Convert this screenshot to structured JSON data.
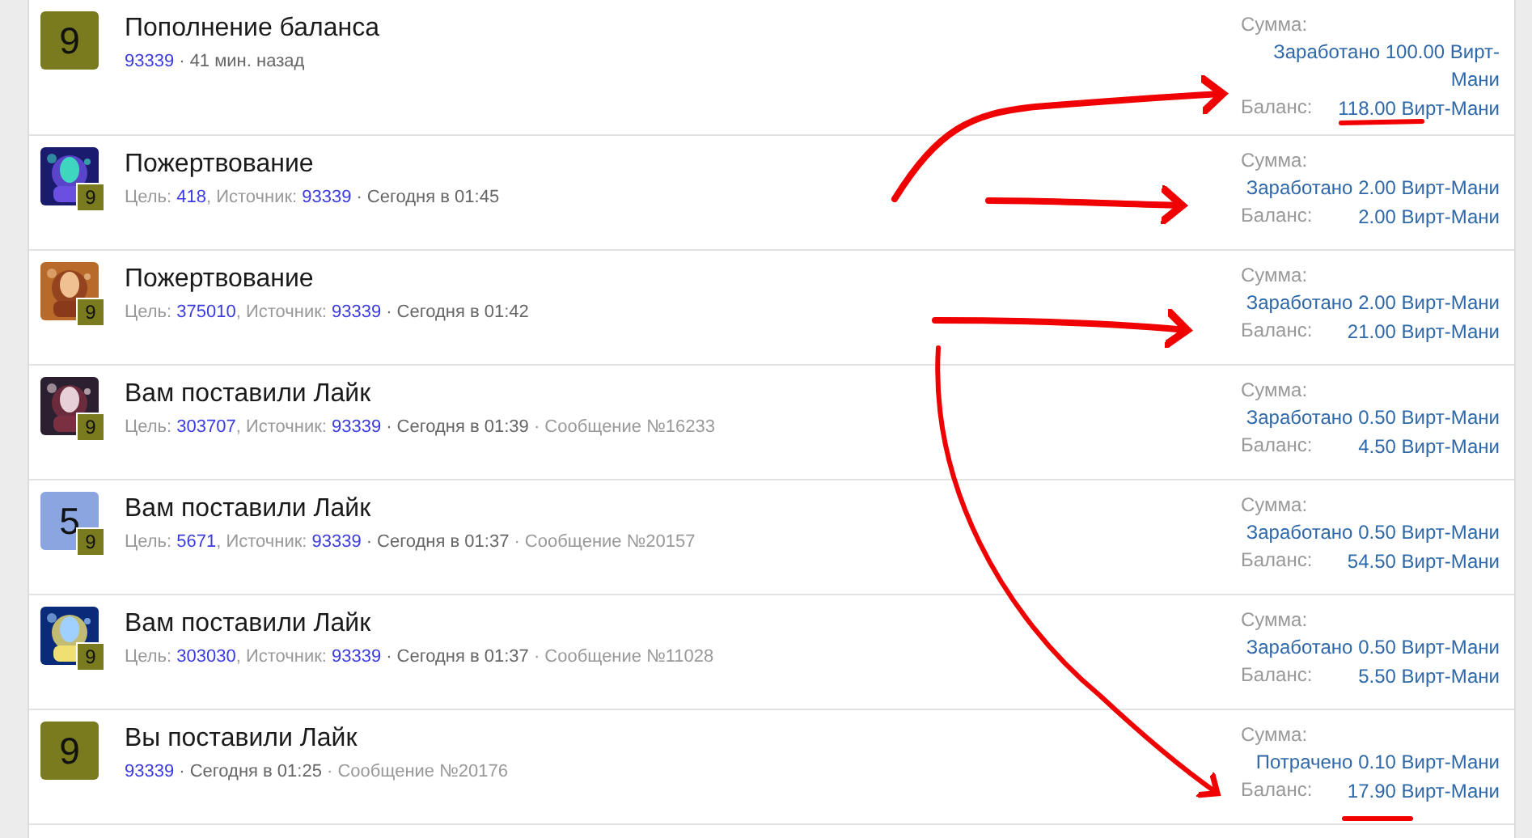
{
  "rows": [
    {
      "title": "Пополнение баланса",
      "avatar": {
        "kind": "number",
        "text": "9",
        "color": "#7a7a1e"
      },
      "meta": [
        {
          "kind": "link",
          "text": "93339"
        },
        {
          "kind": "time",
          "text": "· 41 мин. назад"
        }
      ],
      "sum_label": "Сумма:",
      "amount": "Заработано 100.00 Вирт-Мани",
      "balance_label": "Баланс:",
      "balance": "118.00 Вирт-Мани"
    },
    {
      "title": "Пожертвование",
      "avatar": {
        "kind": "picture",
        "badge": "9"
      },
      "meta": [
        {
          "kind": "label",
          "text": "Цель:"
        },
        {
          "kind": "link",
          "text": "418"
        },
        {
          "kind": "suffix",
          "text": ", Источник:"
        },
        {
          "kind": "link",
          "text": "93339"
        },
        {
          "kind": "time",
          "text": "· Сегодня в 01:45"
        }
      ],
      "sum_label": "Сумма:",
      "amount": "Заработано 2.00 Вирт-Мани",
      "balance_label": "Баланс:",
      "balance": "2.00 Вирт-Мани"
    },
    {
      "title": "Пожертвование",
      "avatar": {
        "kind": "picture",
        "badge": "9"
      },
      "meta": [
        {
          "kind": "label",
          "text": "Цель:"
        },
        {
          "kind": "link",
          "text": "375010"
        },
        {
          "kind": "suffix",
          "text": ", Источник:"
        },
        {
          "kind": "link",
          "text": "93339"
        },
        {
          "kind": "time",
          "text": "· Сегодня в 01:42"
        }
      ],
      "sum_label": "Сумма:",
      "amount": "Заработано 2.00 Вирт-Мани",
      "balance_label": "Баланс:",
      "balance": "21.00 Вирт-Мани"
    },
    {
      "title": "Вам поставили Лайк",
      "avatar": {
        "kind": "picture",
        "badge": "9"
      },
      "meta": [
        {
          "kind": "label",
          "text": "Цель:"
        },
        {
          "kind": "link",
          "text": "303707"
        },
        {
          "kind": "suffix",
          "text": ", Источник:"
        },
        {
          "kind": "link",
          "text": "93339"
        },
        {
          "kind": "time",
          "text": "· Сегодня в 01:39"
        },
        {
          "kind": "label",
          "text": "· Сообщение №16233"
        }
      ],
      "sum_label": "Сумма:",
      "amount": "Заработано 0.50 Вирт-Мани",
      "balance_label": "Баланс:",
      "balance": "4.50 Вирт-Мани"
    },
    {
      "title": "Вам поставили Лайк",
      "avatar": {
        "kind": "number",
        "text": "5",
        "color": "#8aa5e0",
        "badge": "9"
      },
      "meta": [
        {
          "kind": "label",
          "text": "Цель:"
        },
        {
          "kind": "link",
          "text": "5671"
        },
        {
          "kind": "suffix",
          "text": ", Источник:"
        },
        {
          "kind": "link",
          "text": "93339"
        },
        {
          "kind": "time",
          "text": "· Сегодня в 01:37"
        },
        {
          "kind": "label",
          "text": "· Сообщение №20157"
        }
      ],
      "sum_label": "Сумма:",
      "amount": "Заработано 0.50 Вирт-Мани",
      "balance_label": "Баланс:",
      "balance": "54.50 Вирт-Мани"
    },
    {
      "title": "Вам поставили Лайк",
      "avatar": {
        "kind": "picture",
        "badge": "9"
      },
      "meta": [
        {
          "kind": "label",
          "text": "Цель:"
        },
        {
          "kind": "link",
          "text": "303030"
        },
        {
          "kind": "suffix",
          "text": ", Источник:"
        },
        {
          "kind": "link",
          "text": "93339"
        },
        {
          "kind": "time",
          "text": "· Сегодня в 01:37"
        },
        {
          "kind": "label",
          "text": "· Сообщение №11028"
        }
      ],
      "sum_label": "Сумма:",
      "amount": "Заработано 0.50 Вирт-Мани",
      "balance_label": "Баланс:",
      "balance": "5.50 Вирт-Мани"
    },
    {
      "title": "Вы поставили Лайк",
      "avatar": {
        "kind": "number",
        "text": "9",
        "color": "#7a7a1e"
      },
      "meta": [
        {
          "kind": "link",
          "text": "93339"
        },
        {
          "kind": "time",
          "text": "· Сегодня в 01:25"
        },
        {
          "kind": "label",
          "text": "· Сообщение №20176"
        }
      ],
      "sum_label": "Сумма:",
      "amount": "Потрачено 0.10 Вирт-Мани",
      "balance_label": "Баланс:",
      "balance": "17.90 Вирт-Мани"
    }
  ]
}
